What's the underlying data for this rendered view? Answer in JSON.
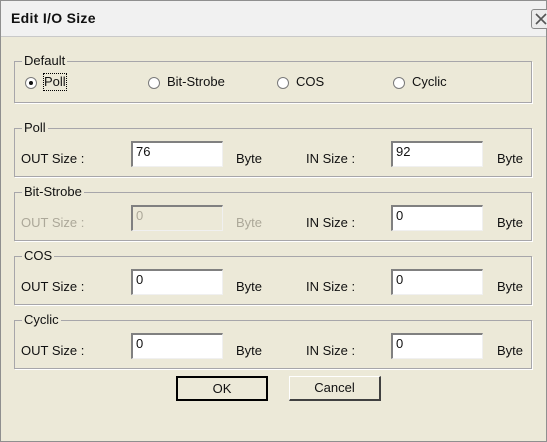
{
  "window": {
    "title": "Edit I/O Size"
  },
  "default_group": {
    "label": "Default",
    "options": [
      {
        "label": "Poll",
        "selected": true
      },
      {
        "label": "Bit-Strobe",
        "selected": false
      },
      {
        "label": "COS",
        "selected": false
      },
      {
        "label": "Cyclic",
        "selected": false
      }
    ]
  },
  "poll": {
    "label": "Poll",
    "out_label": "OUT Size :",
    "out_value": "76",
    "out_unit": "Byte",
    "in_label": "IN Size :",
    "in_value": "92",
    "in_unit": "Byte"
  },
  "bit_strobe": {
    "label": "Bit-Strobe",
    "out_label": "OUT Size :",
    "out_value": "0",
    "out_unit": "Byte",
    "in_label": "IN Size :",
    "in_value": "0",
    "in_unit": "Byte"
  },
  "cos": {
    "label": "COS",
    "out_label": "OUT Size :",
    "out_value": "0",
    "out_unit": "Byte",
    "in_label": "IN Size :",
    "in_value": "0",
    "in_unit": "Byte"
  },
  "cyclic": {
    "label": "Cyclic",
    "out_label": "OUT Size :",
    "out_value": "0",
    "out_unit": "Byte",
    "in_label": "IN Size :",
    "in_value": "0",
    "in_unit": "Byte"
  },
  "buttons": {
    "ok": "OK",
    "cancel": "Cancel"
  }
}
